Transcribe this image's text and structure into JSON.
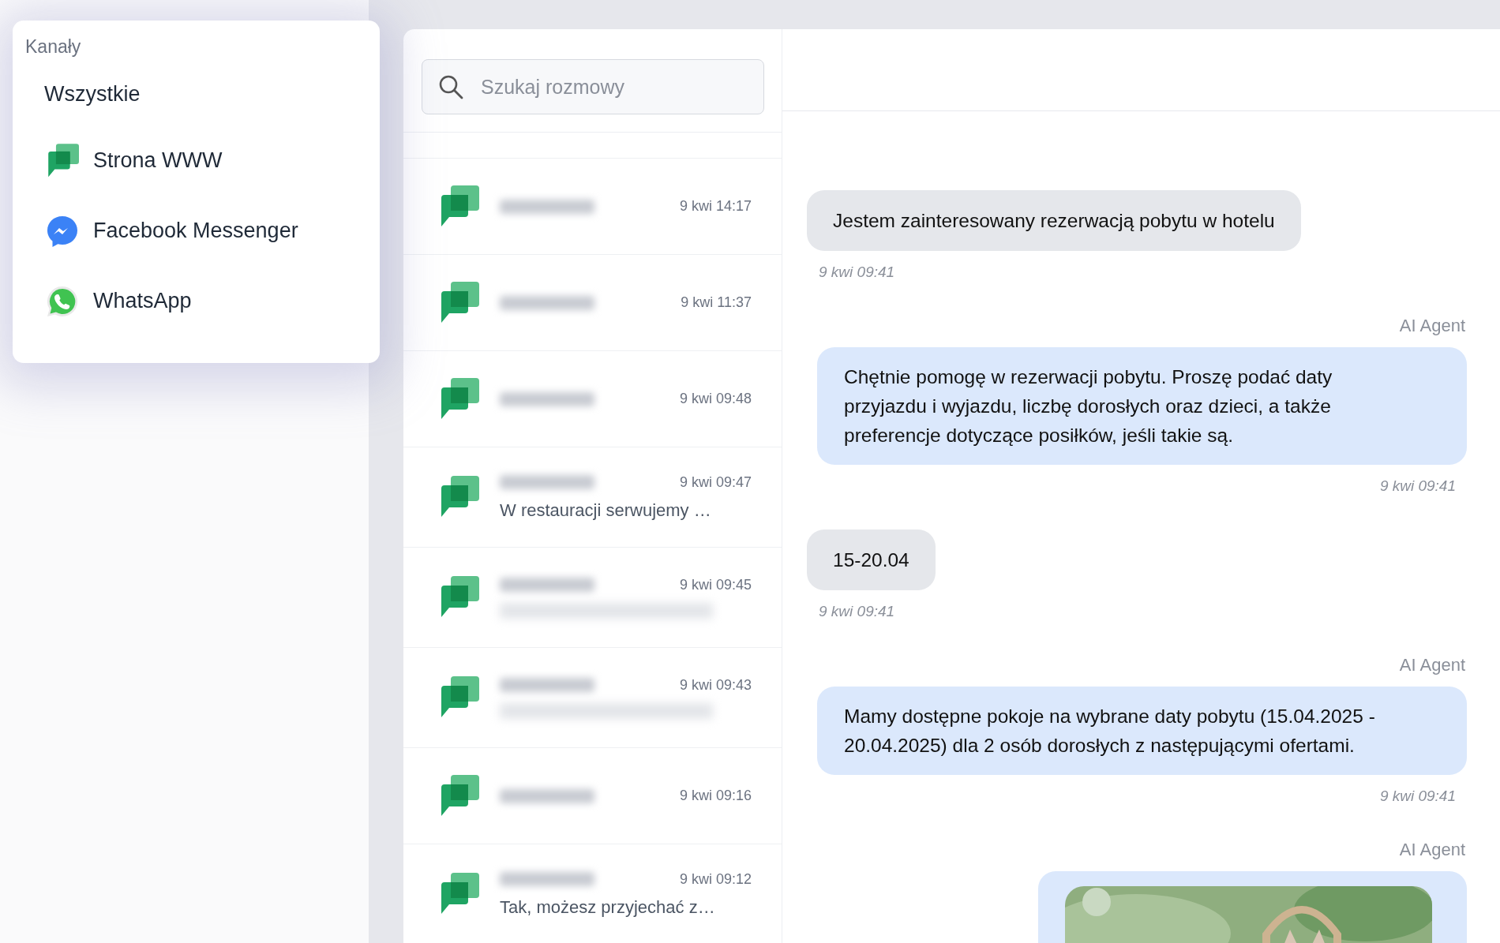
{
  "channels_menu": {
    "title": "Kanały",
    "items": [
      {
        "label": "Wszystkie",
        "kind": "all"
      },
      {
        "label": "Strona WWW",
        "kind": "web"
      },
      {
        "label": "Facebook Messenger",
        "kind": "messenger"
      },
      {
        "label": "WhatsApp",
        "kind": "whatsapp"
      }
    ]
  },
  "search": {
    "placeholder": "Szukaj rozmowy"
  },
  "conversations": [
    {
      "kind": "web",
      "name_hidden": true,
      "time": "9 kwi 14:17"
    },
    {
      "kind": "web",
      "name_hidden": true,
      "time": "9 kwi 11:37"
    },
    {
      "kind": "web",
      "name_hidden": true,
      "time": "9 kwi 09:48"
    },
    {
      "kind": "web",
      "name_hidden": true,
      "time": "9 kwi 09:47",
      "preview": "W restauracji serwujemy …"
    },
    {
      "kind": "web",
      "name_hidden": true,
      "time": "9 kwi 09:45",
      "preview_hidden": true
    },
    {
      "kind": "web",
      "name_hidden": true,
      "time": "9 kwi 09:43",
      "preview_hidden": true
    },
    {
      "kind": "web",
      "name_hidden": true,
      "time": "9 kwi 09:16"
    },
    {
      "kind": "web",
      "name_hidden": true,
      "time": "9 kwi 09:12",
      "preview": "Tak, możesz przyjechać z…"
    }
  ],
  "messages": [
    {
      "kind": "user",
      "text": "Jestem zainteresowany rezerwacją pobytu w hotelu",
      "time": "9 kwi 09:41"
    },
    {
      "kind": "agent",
      "sender": "AI Agent",
      "text": "Chętnie pomogę w rezerwacji pobytu. Proszę podać daty przyjazdu i wyjazdu, liczbę dorosłych oraz dzieci, a także preferencje dotyczące posiłków, jeśli takie są.",
      "time": "9 kwi 09:41"
    },
    {
      "kind": "user",
      "text": "15-20.04",
      "time": "9 kwi 09:41"
    },
    {
      "kind": "agent",
      "sender": "AI Agent",
      "text": "Mamy dostępne pokoje na wybrane daty pobytu (15.04.2025 - 20.04.2025) dla 2 osób dorosłych z następującymi ofertami.",
      "time": "9 kwi 09:41"
    },
    {
      "sender": "AI Agent"
    }
  ]
}
